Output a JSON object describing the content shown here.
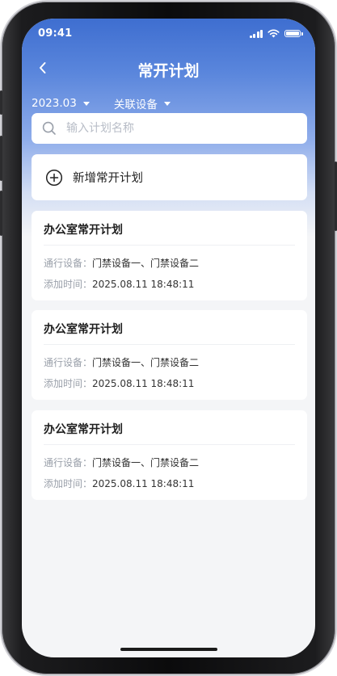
{
  "status_bar": {
    "time": "09:41"
  },
  "nav": {
    "title": "常开计划"
  },
  "filters": [
    {
      "label": "2023.03"
    },
    {
      "label": "关联设备"
    }
  ],
  "search": {
    "placeholder": "输入计划名称",
    "value": ""
  },
  "add_button": {
    "label": "新增常开计划"
  },
  "plans": [
    {
      "title": "办公室常开计划",
      "devices_key": "通行设备：",
      "devices_value": "门禁设备一、门禁设备二",
      "time_key": "添加时间：",
      "time_value": "2025.08.11 18:48:11"
    },
    {
      "title": "办公室常开计划",
      "devices_key": "通行设备：",
      "devices_value": "门禁设备一、门禁设备二",
      "time_key": "添加时间：",
      "time_value": "2025.08.11 18:48:11"
    },
    {
      "title": "办公室常开计划",
      "devices_key": "通行设备：",
      "devices_value": "门禁设备一、门禁设备二",
      "time_key": "添加时间：",
      "time_value": "2025.08.11 18:48:11"
    }
  ],
  "colors": {
    "header_gradient_top": "#3e6ed0",
    "page_background": "#f4f5f7",
    "card_background": "#ffffff",
    "label_gray": "#9aa0aa"
  },
  "icons": {
    "back": "chevron-left-icon",
    "caret": "caret-down-icon",
    "search": "search-icon",
    "add": "plus-circle-icon"
  }
}
